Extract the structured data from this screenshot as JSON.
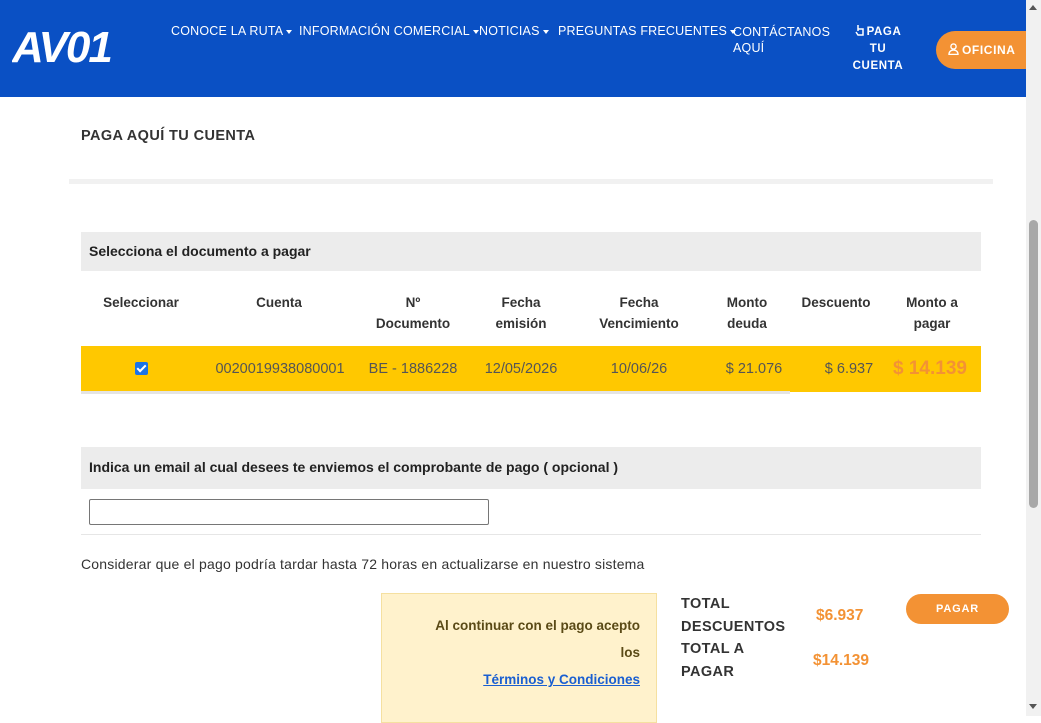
{
  "brand": {
    "logo_text": "AV01",
    "header_color": "#0a50c4",
    "accent_color": "#f39234",
    "highlight_color": "#ffc800"
  },
  "nav": {
    "items": [
      {
        "label": "CONOCE LA RUTA"
      },
      {
        "label": "INFORMACIÓN COMERCIAL"
      },
      {
        "label": "NOTICIAS"
      },
      {
        "label": "PREGUNTAS FRECUENTES"
      }
    ],
    "contact_line1": "CONTÁCTANOS",
    "contact_line2": "AQUÍ",
    "paga_icon": "hand-pointer-icon",
    "paga_line1": "PAGA",
    "paga_line2": "TU",
    "paga_line3": "CUENTA",
    "oficina_icon": "user-icon",
    "oficina_label": "OFICINA"
  },
  "page": {
    "title": "PAGA AQUÍ TU CUENTA"
  },
  "documents": {
    "heading": "Selecciona el documento a pagar",
    "columns": {
      "select": "Seleccionar",
      "cuenta": "Cuenta",
      "doc_l1": "Nº",
      "doc_l2": "Documento",
      "fecha_l1": "Fecha",
      "fecha_l2": "emisión",
      "venc_l1": "Fecha",
      "venc_l2": "Vencimiento",
      "monto_l1": "Monto",
      "monto_l2": "deuda",
      "descuento": "Descuento",
      "pagar_l1": "Monto a",
      "pagar_l2": "pagar"
    },
    "row": {
      "selected": true,
      "cuenta": "0020019938080001",
      "documento": "BE - 1886228",
      "fecha_emision": "12/05/2026",
      "fecha_vencimiento": "10/06/26",
      "monto_deuda": "$ 21.076",
      "descuento": "$ 6.937",
      "monto_pagar": "$ 14.139"
    }
  },
  "email": {
    "heading": "Indica un email al cual desees te enviemos el comprobante de pago ( opcional )",
    "value": "",
    "placeholder": ""
  },
  "note": "Considerar que el pago podría tardar hasta 72 horas en actualizarse en nuestro sistema",
  "terms": {
    "line1": "Al continuar con el pago acepto",
    "line2": "los",
    "link": "Términos y Condiciones"
  },
  "totals": {
    "descuentos_l1": "TOTAL",
    "descuentos_l2": "DESCUENTOS",
    "descuentos_value": "$6.937",
    "pagar_l1": "TOTAL A",
    "pagar_l2": "PAGAR",
    "pagar_value": "$14.139"
  },
  "pay_button": "PAGAR"
}
